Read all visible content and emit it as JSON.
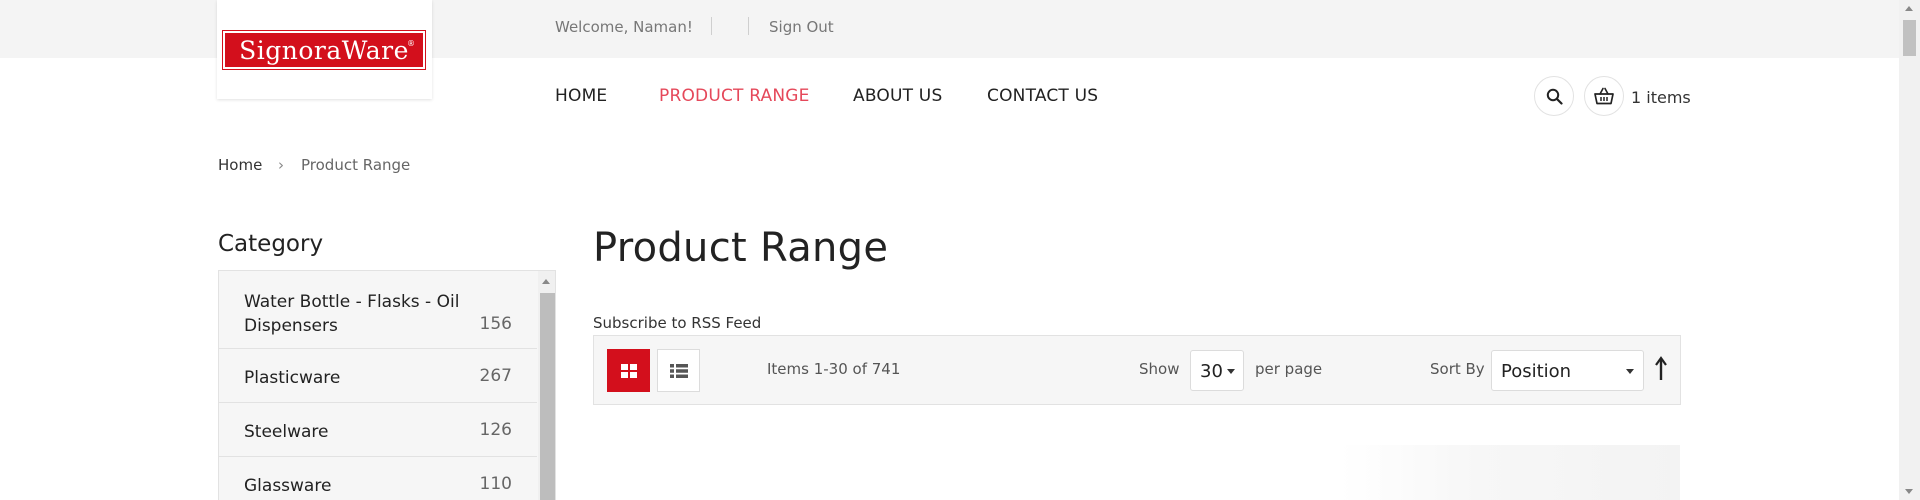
{
  "header": {
    "welcome": "Welcome, Naman!",
    "sign_out": "Sign Out",
    "logo_text": "SignoraWare",
    "logo_mark": "®",
    "brand_color": "#d30f1c"
  },
  "nav": {
    "items": [
      {
        "label": "HOME"
      },
      {
        "label": "PRODUCT RANGE",
        "active": true
      },
      {
        "label": "ABOUT US"
      },
      {
        "label": "CONTACT US"
      }
    ],
    "active_color": "#e5485a",
    "search_icon": "search-icon",
    "cart_icon": "basket-icon",
    "cart_count": "1 items"
  },
  "breadcrumb": {
    "home": "Home",
    "separator": "›",
    "current": "Product Range"
  },
  "sidebar": {
    "title": "Category",
    "categories": [
      {
        "name": "Water Bottle - Flasks - Oil Dispensers",
        "count": "156"
      },
      {
        "name": "Plasticware",
        "count": "267"
      },
      {
        "name": "Steelware",
        "count": "126"
      },
      {
        "name": "Glassware",
        "count": "110"
      }
    ]
  },
  "main": {
    "title": "Product Range",
    "rss": "Subscribe to RSS Feed",
    "toolbar": {
      "grid_icon": "grid-view-icon",
      "list_icon": "list-view-icon",
      "items_text": "Items 1-30 of 741",
      "show_label": "Show",
      "limit_value": "30",
      "per_page": "per page",
      "sort_label": "Sort By",
      "sort_value": "Position",
      "sort_direction_icon": "arrow-up-icon"
    }
  }
}
